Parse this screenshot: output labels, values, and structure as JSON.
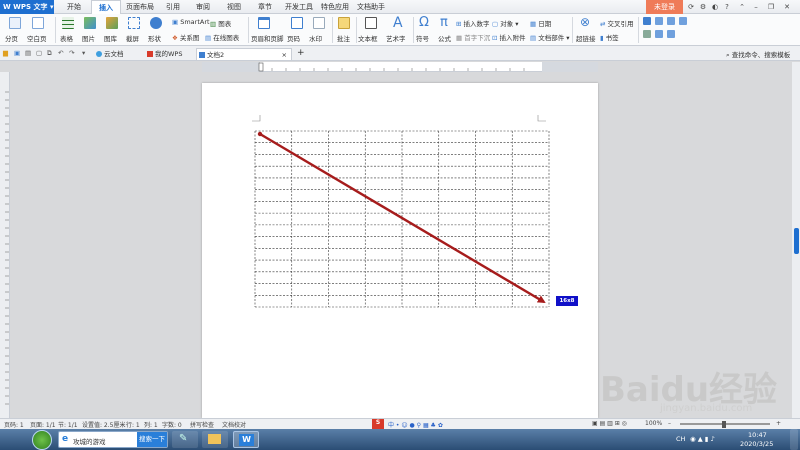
{
  "app": {
    "name": "WPS 文字"
  },
  "menu": {
    "tabs": [
      "开始",
      "插入",
      "页面布局",
      "引用",
      "审阅",
      "视图",
      "章节",
      "开发工具",
      "特色应用",
      "文档助手"
    ],
    "active": "插入",
    "login": "未登录"
  },
  "ribbon": {
    "page_break": "分页",
    "blank_page": "空白页",
    "table": "表格",
    "picture": "图片",
    "gallery": "图库",
    "screenshot": "截屏",
    "shapes": "形状",
    "smartart": "SmartArt",
    "chart": "图表",
    "relation": "关系图",
    "online_chart": "在线图表",
    "header_footer": "页眉和页脚",
    "page_number": "页码",
    "watermark": "水印",
    "comment": "批注",
    "textbox": "文本框",
    "wordart": "艺术字",
    "symbol": "符号",
    "formula": "公式",
    "insert_number": "插入数字",
    "object": "对象",
    "date": "日期",
    "first_letter": "首字下沉",
    "attachment": "插入附件",
    "doc_parts": "文档部件",
    "hyperlink": "超链接",
    "cross_ref": "交叉引用",
    "bookmark": "书签"
  },
  "tabs": {
    "items": [
      "云文档",
      "我的WPS",
      "文档2"
    ],
    "active": "文档2",
    "add": "+",
    "search": "查找命令、搜索模板"
  },
  "document": {
    "table_rows": 15,
    "table_cols": 8,
    "label": "16x8"
  },
  "status": {
    "page": "页码: 1",
    "pages": "页面: 1/1",
    "section": "节: 1/1",
    "setting": "设置值: 2.5厘米",
    "row": "行: 1",
    "col": "列: 1",
    "words": "字数: 0",
    "spell": "拼写检查",
    "proof": "文档校对",
    "zoom": "100%"
  },
  "taskbar": {
    "search_text": "攻城的游戏",
    "search_btn": "搜索一下",
    "time": "10:47",
    "date": "2020/3/25",
    "lang": "CH"
  },
  "watermark": {
    "text": "Baidu经验",
    "url": "jingyan.baidu.com"
  },
  "colors": {
    "accent": "#1e6fd0",
    "arrow": "#a61c1c",
    "login": "#ef7b58",
    "label_bg": "#1010c8"
  }
}
